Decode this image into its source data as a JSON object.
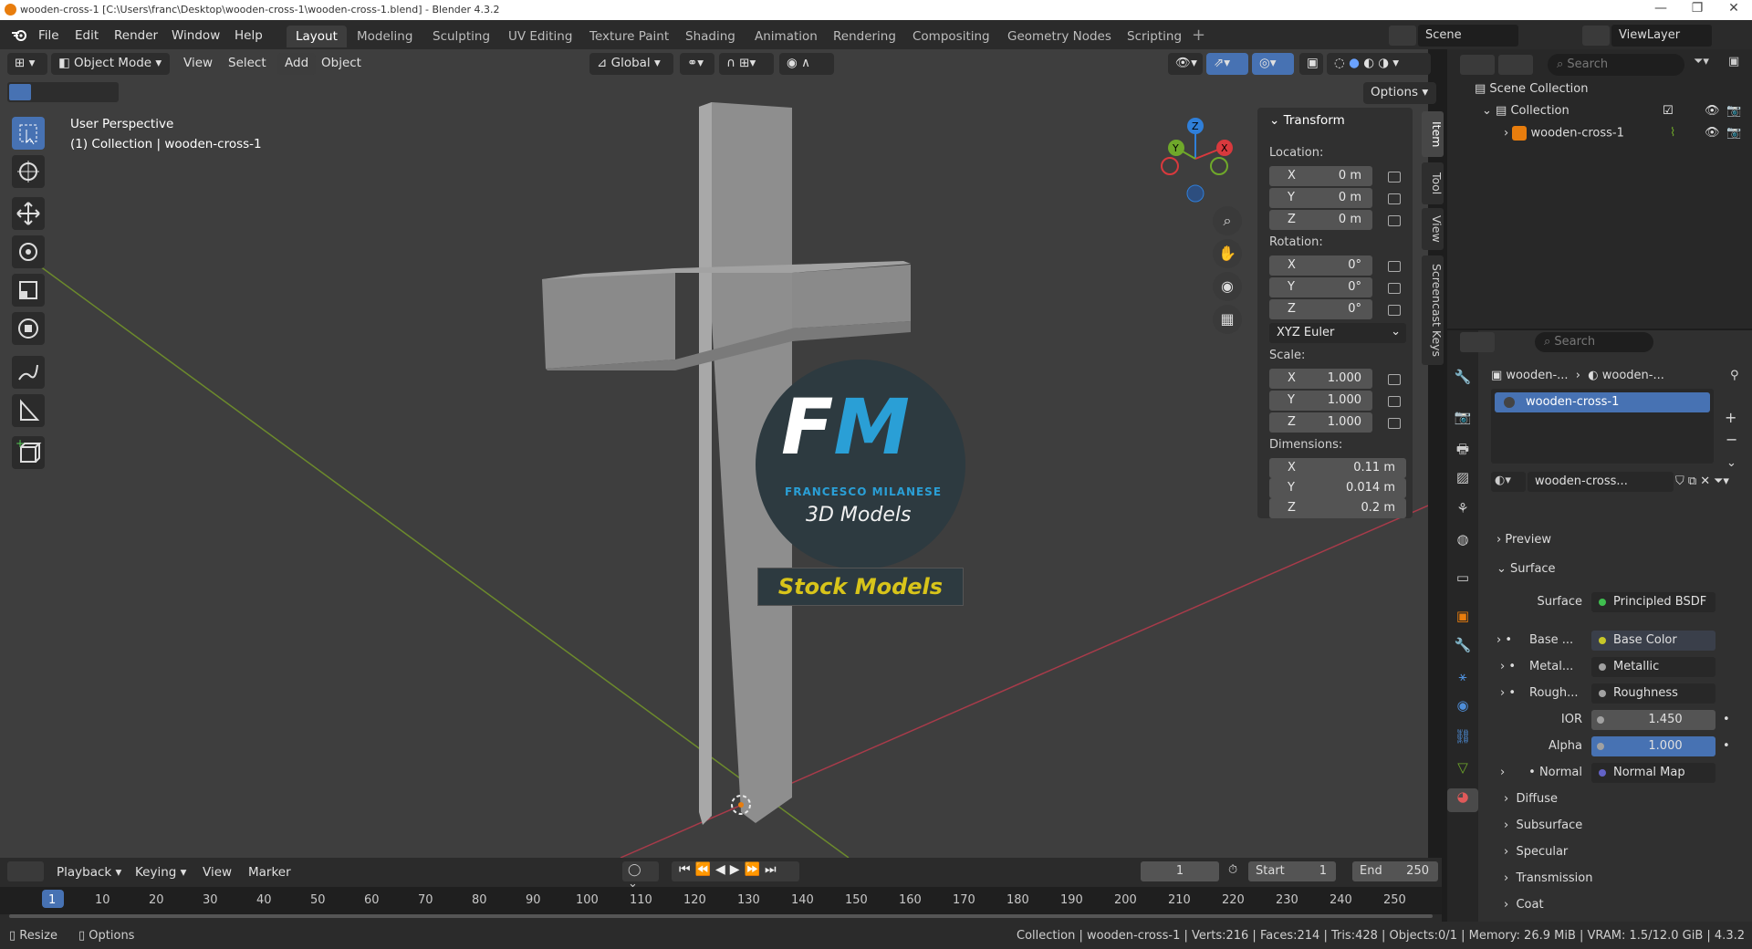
{
  "window": {
    "title": "wooden-cross-1 [C:\\Users\\franc\\Desktop\\wooden-cross-1\\wooden-cross-1.blend] - Blender 4.3.2"
  },
  "menu": [
    "File",
    "Edit",
    "Render",
    "Window",
    "Help"
  ],
  "workspaces": [
    "Layout",
    "Modeling",
    "Sculpting",
    "UV Editing",
    "Texture Paint",
    "Shading",
    "Animation",
    "Rendering",
    "Compositing",
    "Geometry Nodes",
    "Scripting"
  ],
  "scene": {
    "name": "Scene",
    "view_layer": "ViewLayer"
  },
  "viewport_header": {
    "mode": "Object Mode",
    "menus": [
      "View",
      "Select",
      "Add",
      "Object"
    ],
    "transform_orientation": "Global",
    "options": "Options"
  },
  "viewport": {
    "perspective": "User Perspective",
    "collection_info": "(1) Collection | wooden-cross-1",
    "watermark": {
      "initials": "FM",
      "name": "FRANCESCO MILANESE",
      "sub": "3D Models",
      "banner": "Stock Models"
    },
    "gizmo": {
      "x": "X",
      "y": "Y",
      "z": "Z"
    }
  },
  "npanel": {
    "title": "Transform",
    "location_label": "Location:",
    "location": [
      {
        "axis": "X",
        "value": "0 m"
      },
      {
        "axis": "Y",
        "value": "0 m"
      },
      {
        "axis": "Z",
        "value": "0 m"
      }
    ],
    "rotation_label": "Rotation:",
    "rotation": [
      {
        "axis": "X",
        "value": "0°"
      },
      {
        "axis": "Y",
        "value": "0°"
      },
      {
        "axis": "Z",
        "value": "0°"
      }
    ],
    "rotation_mode": "XYZ Euler",
    "scale_label": "Scale:",
    "scale": [
      {
        "axis": "X",
        "value": "1.000"
      },
      {
        "axis": "Y",
        "value": "1.000"
      },
      {
        "axis": "Z",
        "value": "1.000"
      }
    ],
    "dimensions_label": "Dimensions:",
    "dimensions": [
      {
        "axis": "X",
        "value": "0.11 m"
      },
      {
        "axis": "Y",
        "value": "0.014 m"
      },
      {
        "axis": "Z",
        "value": "0.2 m"
      }
    ],
    "tabs": [
      "Item",
      "Tool",
      "View",
      "Screencast Keys"
    ]
  },
  "outliner": {
    "search_placeholder": "Search",
    "items": [
      {
        "label": "Scene Collection"
      },
      {
        "label": "Collection"
      },
      {
        "label": "wooden-cross-1"
      }
    ]
  },
  "properties": {
    "search_placeholder": "Search",
    "breadcrumb": [
      "wooden-...",
      "wooden-..."
    ],
    "material_slot": "wooden-cross-1",
    "material_name": "wooden-cross...",
    "sections": {
      "preview": "Preview",
      "surface": "Surface"
    },
    "surface_rows": [
      {
        "label": "Surface",
        "value": "Principled BSDF",
        "dot": "#3fbf4f"
      },
      {
        "label": "Base ...",
        "value": "Base Color",
        "dot": "#c7c729"
      },
      {
        "label": "Metal...",
        "value": "Metallic",
        "dot": "#a1a1a1"
      },
      {
        "label": "Rough...",
        "value": "Roughness",
        "dot": "#a1a1a1"
      },
      {
        "label": "IOR",
        "value": "1.450",
        "dot": "#a1a1a1"
      },
      {
        "label": "Alpha",
        "value": "1.000",
        "dot": "#a1a1a1"
      },
      {
        "label": "Normal",
        "value": "Normal Map",
        "dot": "#6363c7"
      }
    ],
    "subpanels": [
      "Diffuse",
      "Subsurface",
      "Specular",
      "Transmission",
      "Coat"
    ]
  },
  "timeline": {
    "menus": [
      "Playback",
      "Keying",
      "View",
      "Marker"
    ],
    "current_frame": "1",
    "start_label": "Start",
    "start": "1",
    "end_label": "End",
    "end": "250",
    "ruler": [
      "1",
      "10",
      "20",
      "30",
      "40",
      "50",
      "60",
      "70",
      "80",
      "90",
      "100",
      "110",
      "120",
      "130",
      "140",
      "150",
      "160",
      "170",
      "180",
      "190",
      "200",
      "210",
      "220",
      "230",
      "240",
      "250"
    ]
  },
  "statusbar": {
    "left": [
      "Resize",
      "Options"
    ],
    "stats": "Collection | wooden-cross-1 | Verts:216 | Faces:214 | Tris:428 | Objects:0/1 | Memory: 26.9 MiB | VRAM: 1.5/12.0 GiB | 4.3.2"
  },
  "colors": {
    "accent": "#4772b3",
    "active_object": "#e87d0d",
    "watermark_blue": "#2a9fd6",
    "watermark_yellow": "#d8c41a"
  }
}
